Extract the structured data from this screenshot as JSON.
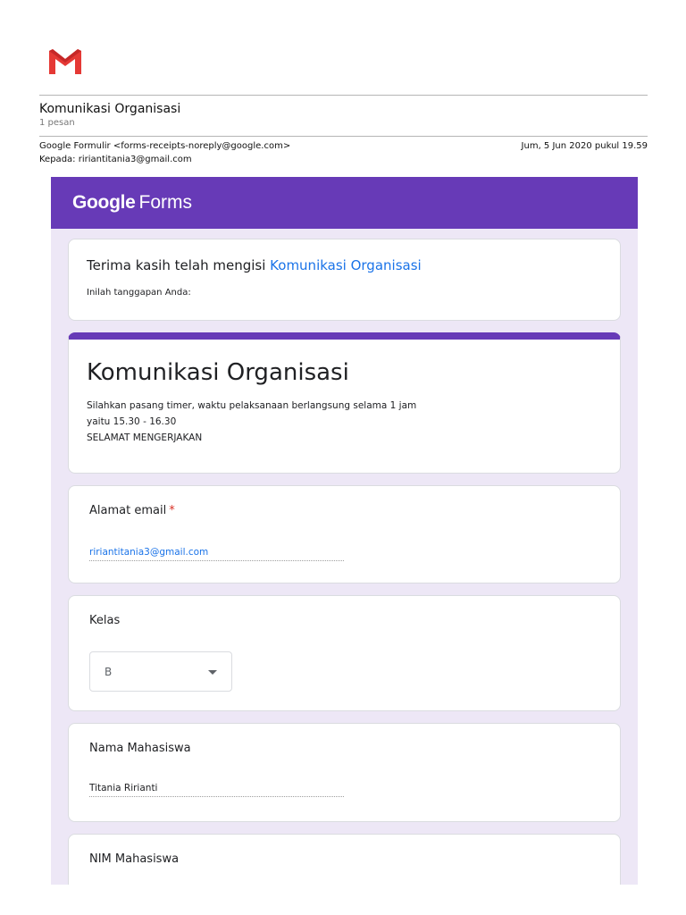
{
  "email": {
    "subject": "Komunikasi Organisasi",
    "message_count": "1 pesan",
    "from": "Google Formulir <forms-receipts-noreply@google.com>",
    "to": "Kepada: ririantitania3@gmail.com",
    "date": "Jum, 5 Jun 2020 pukul 19.59"
  },
  "brand": {
    "gmail_icon": "gmail-icon",
    "google": "Google",
    "forms": "Forms",
    "accent": "#673ab7",
    "background": "#ede7f6",
    "link_color": "#1a73e8",
    "required_color": "#d93025"
  },
  "receipt": {
    "thanks_prefix": "Terima kasih telah mengisi",
    "form_link": "Komunikasi Organisasi",
    "subtitle": "Inilah tanggapan Anda:"
  },
  "form": {
    "title": "Komunikasi Organisasi",
    "description_lines": [
      "Silahkan pasang timer, waktu pelaksanaan berlangsung selama 1 jam",
      "yaitu 15.30 - 16.30",
      "SELAMAT MENGERJAKAN"
    ],
    "questions": [
      {
        "label": "Alamat email",
        "required_mark": "*",
        "answer": "ririantitania3@gmail.com"
      },
      {
        "label": "Kelas",
        "answer": "B",
        "dropdown_icon": "arrow-drop-down-icon"
      },
      {
        "label": "Nama Mahasiswa",
        "answer": "Titania Ririanti"
      },
      {
        "label": "NIM Mahasiswa"
      }
    ]
  }
}
